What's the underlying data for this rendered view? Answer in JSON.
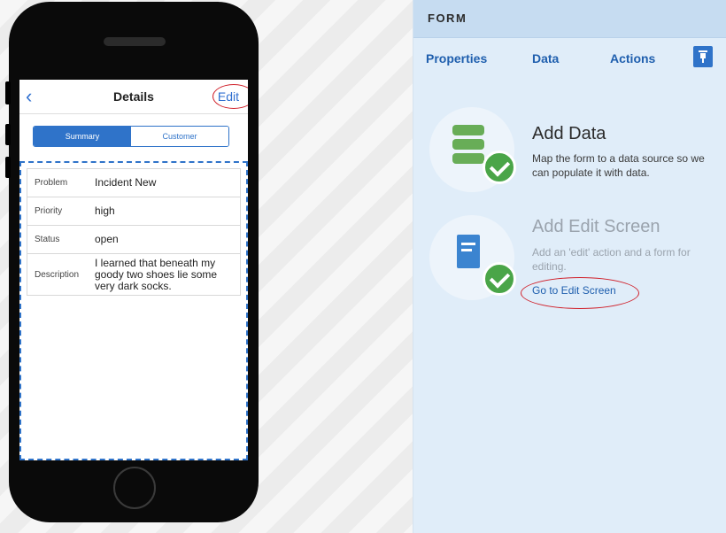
{
  "phone": {
    "nav": {
      "title": "Details",
      "edit_label": "Edit",
      "back_icon": "chevron-left-icon"
    },
    "segments": [
      "Summary",
      "Customer"
    ],
    "rows": [
      {
        "label": "Problem",
        "value": "Incident New"
      },
      {
        "label": "Priority",
        "value": "high"
      },
      {
        "label": "Status",
        "value": "open"
      },
      {
        "label": "Description",
        "value": "I learned that beneath my goody two shoes lie some very dark socks."
      }
    ]
  },
  "panel": {
    "title": "FORM",
    "tabs": [
      "Properties",
      "Data",
      "Actions"
    ],
    "pin_icon": "pin-icon",
    "steps": [
      {
        "title": "Add Data",
        "text": "Map the form to a data source so we can populate it with data.",
        "icon": "database-icon"
      },
      {
        "title": "Add Edit Screen",
        "text": "Add an 'edit' action and a form for editing.",
        "icon": "document-icon",
        "link": "Go to Edit Screen"
      }
    ]
  },
  "colors": {
    "accent": "#2f73c9",
    "panel_bg": "#e0edf9",
    "success": "#4aa548",
    "highlight": "#d0202a"
  }
}
